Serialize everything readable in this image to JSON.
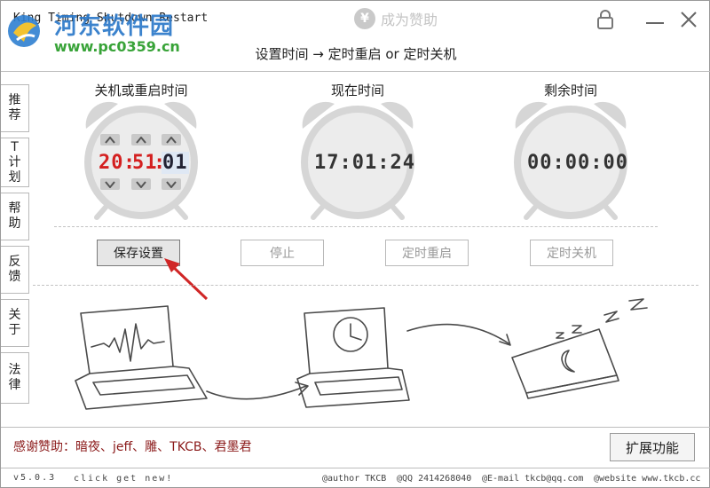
{
  "title_bar": {
    "app_title": "King Timing Shutdown Restart",
    "watermark_text": "河东软件园",
    "watermark_url": "www.pc0359.cn",
    "donate_label": "成为赞助",
    "donate_coin_glyph": "¥",
    "icons": [
      "lock-icon",
      "minimize-icon",
      "close-icon"
    ]
  },
  "subtitle": "设置时间 → 定时重启 or 定时关机",
  "sidebar": {
    "items": [
      {
        "label": "推\n荐"
      },
      {
        "label": "T\n计\n划"
      },
      {
        "label": "帮\n助"
      },
      {
        "label": "反\n馈"
      },
      {
        "label": "关\n于"
      },
      {
        "label": "法\n律"
      }
    ]
  },
  "clocks": {
    "set_time": {
      "title": "关机或重启时间",
      "hour": "20",
      "minute": "51",
      "second": "01"
    },
    "current_time": {
      "title": "现在时间",
      "value": "17:01:24"
    },
    "remaining_time": {
      "title": "剩余时间",
      "value": "00:00:00"
    }
  },
  "buttons": {
    "save": "保存设置",
    "stop": "停止",
    "timed_restart": "定时重启",
    "timed_shutdown": "定时关机",
    "extend": "扩展功能"
  },
  "illustration": {
    "sleep_text": "z z Z Z"
  },
  "footer": {
    "thanks": "感谢赞助：暗夜、jeff、雕、TKCB、君墨君",
    "version": "v5.0.3",
    "click_new": "click get new!",
    "author": "@author TKCB",
    "qq": "@QQ 2414268040",
    "email": "@E-mail tkcb@qq.com",
    "website": "@website www.tkcb.cc"
  },
  "colors": {
    "accent_red": "#d42020",
    "digit_dark": "#333333",
    "selected_digit_bg": "#dfe8f4",
    "watermark_blue": "#2c79c9",
    "watermark_green": "#38a338",
    "thanks_red": "#8b1a1a"
  }
}
